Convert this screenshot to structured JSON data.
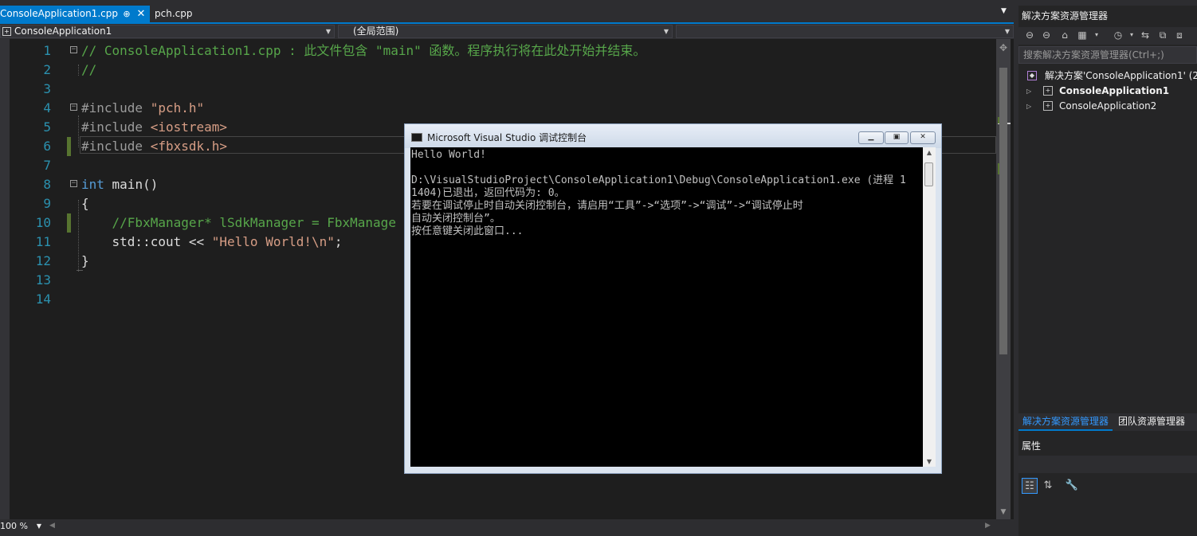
{
  "tabs": [
    {
      "label": "ConsoleApplication1.cpp",
      "active": true,
      "pin": "⊕",
      "close": "✕"
    },
    {
      "label": "pch.cpp",
      "active": false
    }
  ],
  "nav": {
    "project": "ConsoleApplication1",
    "scope": "(全局范围)",
    "member": ""
  },
  "editor": {
    "lines": [
      {
        "num": "1",
        "segments": [
          {
            "cls": "c-com",
            "text": "// ConsoleApplication1.cpp : 此文件包含 \"main\" 函数。程序执行将在此处开始并结束。"
          }
        ]
      },
      {
        "num": "2",
        "segments": [
          {
            "cls": "c-com",
            "text": "//"
          }
        ]
      },
      {
        "num": "3",
        "segments": []
      },
      {
        "num": "4",
        "segments": [
          {
            "cls": "c-pp",
            "text": "#include "
          },
          {
            "cls": "c-str",
            "text": "\"pch.h\""
          }
        ]
      },
      {
        "num": "5",
        "segments": [
          {
            "cls": "c-pp",
            "text": "#include "
          },
          {
            "cls": "c-str",
            "text": "<iostream>"
          }
        ]
      },
      {
        "num": "6",
        "segments": [
          {
            "cls": "c-pp",
            "text": "#include "
          },
          {
            "cls": "c-str",
            "text": "<fbxsdk.h>"
          }
        ]
      },
      {
        "num": "7",
        "segments": []
      },
      {
        "num": "8",
        "segments": [
          {
            "cls": "c-kw",
            "text": "int"
          },
          {
            "cls": "c-txt",
            "text": " main()"
          }
        ]
      },
      {
        "num": "9",
        "segments": [
          {
            "cls": "c-txt",
            "text": "{"
          }
        ]
      },
      {
        "num": "10",
        "segments": [
          {
            "cls": "c-com",
            "text": "    //FbxManager* lSdkManager = FbxManage"
          }
        ]
      },
      {
        "num": "11",
        "segments": [
          {
            "cls": "c-txt",
            "text": "    std::cout << "
          },
          {
            "cls": "c-str",
            "text": "\"Hello World!\\n\""
          },
          {
            "cls": "c-txt",
            "text": ";"
          }
        ]
      },
      {
        "num": "12",
        "segments": [
          {
            "cls": "c-txt",
            "text": "}"
          }
        ]
      },
      {
        "num": "13",
        "segments": []
      },
      {
        "num": "14",
        "segments": []
      }
    ],
    "zoom": "100 %"
  },
  "console": {
    "title": "Microsoft Visual Studio 调试控制台",
    "min": "▁",
    "max": "▣",
    "close": "✕",
    "output": "Hello World!\n\nD:\\VisualStudioProject\\ConsoleApplication1\\Debug\\ConsoleApplication1.exe (进程 1\n1404)已退出，返回代码为: 0。\n若要在调试停止时自动关闭控制台，请启用“工具”->“选项”->“调试”->“调试停止时\n自动关闭控制台”。\n按任意键关闭此窗口..."
  },
  "solution_explorer": {
    "title": "解决方案资源管理器",
    "search_placeholder": "搜索解决方案资源管理器(Ctrl+;)",
    "solution": "解决方案'ConsoleApplication1' (2",
    "projects": [
      "ConsoleApplication1",
      "ConsoleApplication2"
    ]
  },
  "panel_tabs": [
    "解决方案资源管理器",
    "团队资源管理器"
  ],
  "properties": {
    "title": "属性"
  },
  "colors": {
    "accent": "#007acc",
    "editor_bg": "#1e1e1e",
    "comment": "#57a64a",
    "string": "#d69d85",
    "keyword": "#569cd6",
    "line_number": "#2b91af"
  }
}
